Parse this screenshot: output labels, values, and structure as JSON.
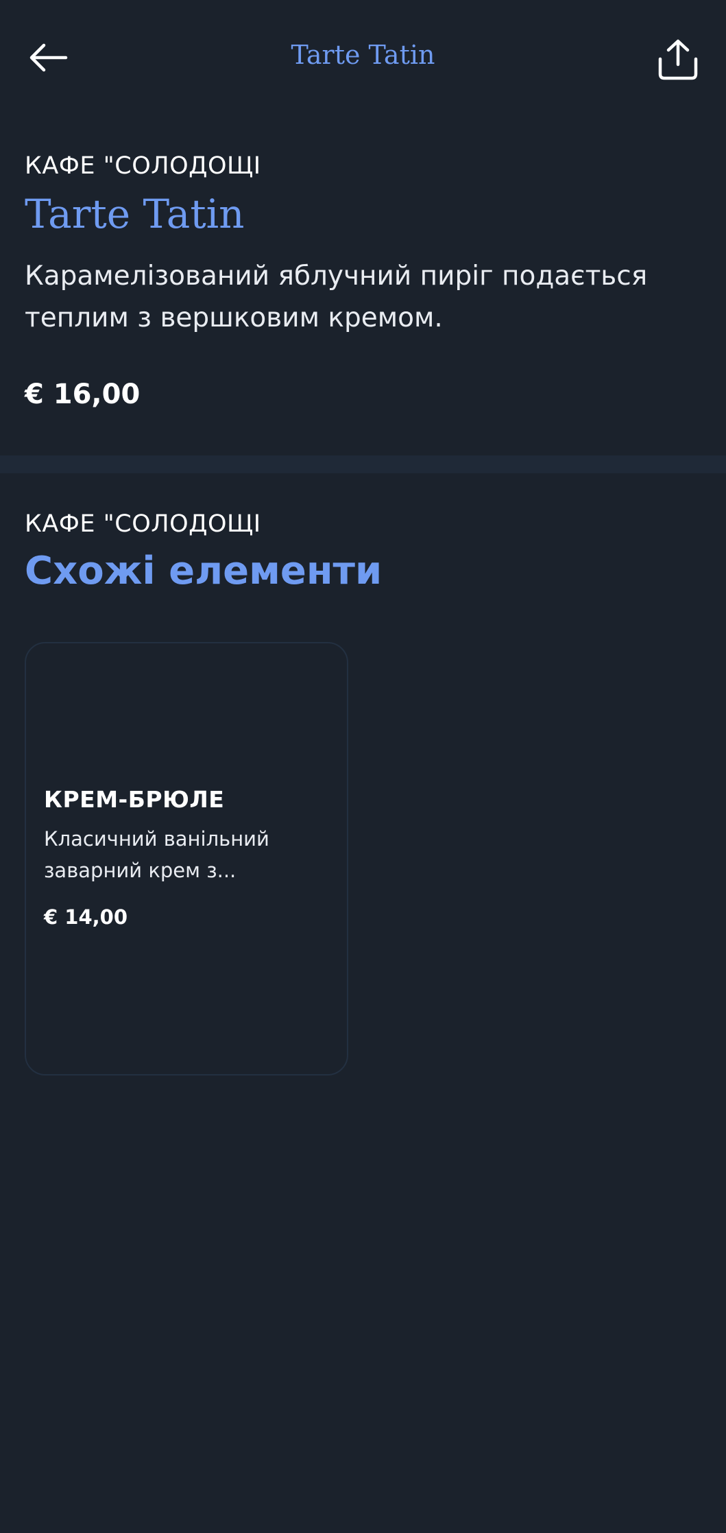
{
  "header": {
    "title": "Tarte Tatin"
  },
  "item": {
    "venue": "КАФЕ \"СОЛОДОЩІ",
    "name": "Tarte Tatin",
    "description": "Карамелізований яблучний пиріг подається теплим з вершковим кремом.",
    "price": "€ 16,00"
  },
  "similar": {
    "venue": "КАФЕ \"СОЛОДОЩІ",
    "heading": "Схожі елементи",
    "items": [
      {
        "name": "КРЕМ-БРЮЛЕ",
        "description": "Класичний ванільний заварний крем з...",
        "price": "€ 14,00"
      }
    ]
  },
  "icons": {
    "back": "arrow-left-icon",
    "share": "share-icon"
  },
  "colors": {
    "background": "#1b222c",
    "accent": "#6f9bf1",
    "divider": "#1f2937"
  }
}
